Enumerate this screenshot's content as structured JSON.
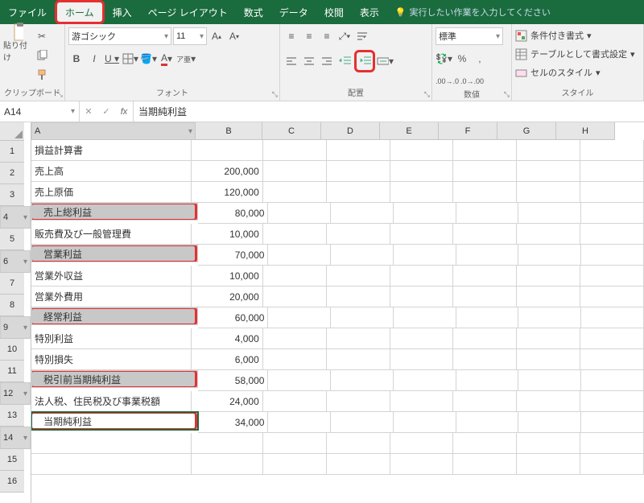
{
  "tabs": {
    "file": "ファイル",
    "home": "ホーム",
    "insert": "挿入",
    "pagelayout": "ページ レイアウト",
    "formulas": "数式",
    "data": "データ",
    "review": "校閲",
    "view": "表示",
    "tell": "実行したい作業を入力してください"
  },
  "ribbon": {
    "clipboard": {
      "label": "クリップボード",
      "paste": "貼り付け"
    },
    "font": {
      "label": "フォント",
      "name": "游ゴシック",
      "size": "11"
    },
    "align": {
      "label": "配置"
    },
    "number": {
      "label": "数値",
      "format": "標準"
    },
    "style": {
      "label": "スタイル",
      "cond": "条件付き書式",
      "table": "テーブルとして書式設定",
      "cell": "セルのスタイル"
    }
  },
  "formula": {
    "ref": "A14",
    "value": "当期純利益"
  },
  "cols": [
    "A",
    "B",
    "C",
    "D",
    "E",
    "F",
    "G",
    "H"
  ],
  "rows": [
    {
      "n": 1,
      "a": "損益計算書",
      "b": ""
    },
    {
      "n": 2,
      "a": "売上高",
      "b": "200,000"
    },
    {
      "n": 3,
      "a": "売上原価",
      "b": "120,000"
    },
    {
      "n": 4,
      "a": "売上総利益",
      "b": "80,000",
      "sel": true,
      "hl": true,
      "indent": true
    },
    {
      "n": 5,
      "a": "販売費及び一般管理費",
      "b": "10,000"
    },
    {
      "n": 6,
      "a": "営業利益",
      "b": "70,000",
      "sel": true,
      "hl": true,
      "indent": true
    },
    {
      "n": 7,
      "a": "営業外収益",
      "b": "10,000"
    },
    {
      "n": 8,
      "a": "営業外費用",
      "b": "20,000"
    },
    {
      "n": 9,
      "a": "経常利益",
      "b": "60,000",
      "sel": true,
      "hl": true,
      "indent": true
    },
    {
      "n": 10,
      "a": "特別利益",
      "b": "4,000"
    },
    {
      "n": 11,
      "a": "特別損失",
      "b": "6,000"
    },
    {
      "n": 12,
      "a": "税引前当期純利益",
      "b": "58,000",
      "sel": true,
      "hl": true,
      "indent": true
    },
    {
      "n": 13,
      "a": "法人税、住民税及び事業税額",
      "b": "24,000"
    },
    {
      "n": 14,
      "a": "当期純利益",
      "b": "34,000",
      "sel": true,
      "hl": true,
      "indent": true,
      "active": true
    },
    {
      "n": 15,
      "a": "",
      "b": ""
    },
    {
      "n": 16,
      "a": "",
      "b": ""
    }
  ]
}
